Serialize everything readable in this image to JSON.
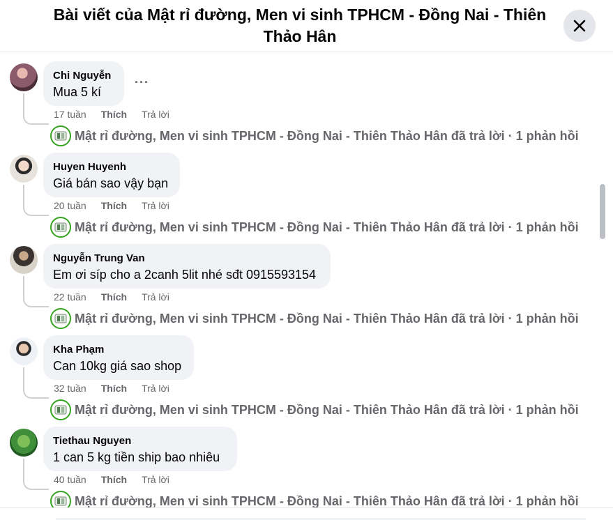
{
  "dialog": {
    "title": "Bài viết của Mật rỉ đường, Men vi sinh TPHCM - Đồng Nai - Thiên Thảo Hân",
    "close_icon": "close-icon"
  },
  "labels": {
    "like": "Thích",
    "reply": "Trả lời",
    "page_reply": "Mật rỉ đường, Men vi sinh TPHCM - Đồng Nai - Thiên Thảo Hân đã trả lời · 1 phản hồi"
  },
  "colors": {
    "bubble": "#f0f2f5",
    "secondary_text": "#65676b",
    "page_ring": "#36a420"
  },
  "comments": [
    {
      "author": "Chi Nguyễn",
      "text": "Mua 5 kí",
      "time": "17 tuần",
      "avatar": "#8b5a6b"
    },
    {
      "author": "Huyen Huyenh",
      "text": "Giá bán sao vậy bạn",
      "time": "20 tuần",
      "avatar": "#d9c7b8"
    },
    {
      "author": "Nguyễn Trung Van",
      "text": "Em ơi síp cho a 2canh 5lit nhé sđt 0915593154",
      "time": "22 tuần",
      "avatar": "#a08a70"
    },
    {
      "author": "Kha Phạm",
      "text": "Can 10kg giá sao shop",
      "time": "32 tuần",
      "avatar": "#c9d3e0"
    },
    {
      "author": "Tiethau Nguyen",
      "text": "1 can 5 kg tiền ship bao nhiêu",
      "time": "40 tuần",
      "avatar": "#3f8f3a"
    }
  ]
}
